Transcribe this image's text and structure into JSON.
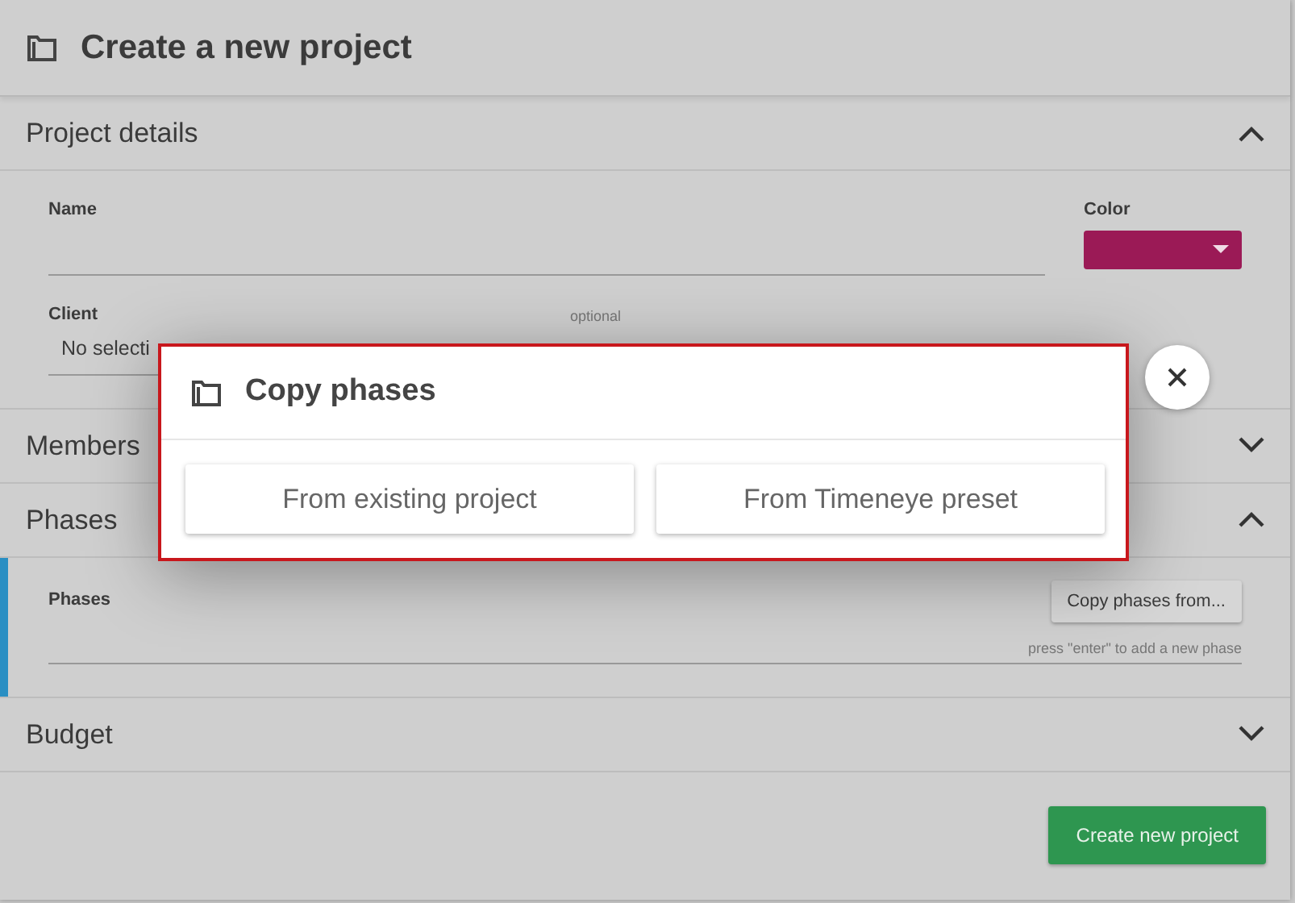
{
  "window": {
    "title": "Create a new project"
  },
  "sections": [
    {
      "kind": "details",
      "title": "Project details",
      "expanded": true,
      "active": false,
      "name_label": "Name",
      "color_label": "Color",
      "color": "#9b1a56",
      "client_label": "Client",
      "client_hint": "optional",
      "client_value": "No selecti"
    },
    {
      "kind": "plain",
      "title": "Members",
      "expanded": false,
      "active": false
    },
    {
      "kind": "phases",
      "title": "Phases",
      "expanded": true,
      "active": true,
      "phases_label": "Phases",
      "copy_button": "Copy phases from...",
      "hint": "press \"enter\" to add a new phase"
    },
    {
      "kind": "plain",
      "title": "Budget",
      "expanded": false,
      "active": false
    }
  ],
  "footer": {
    "button": "Create new project"
  },
  "dialog": {
    "title": "Copy phases",
    "options": [
      "From existing project",
      "From Timeneye preset"
    ]
  }
}
